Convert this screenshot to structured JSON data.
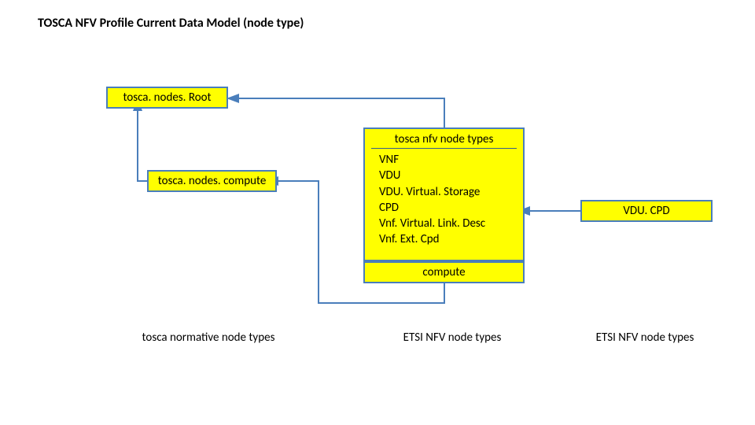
{
  "title": "TOSCA NFV Profile Current Data Model (node type)",
  "boxes": {
    "root": "tosca. nodes. Root",
    "compute": "tosca. nodes. compute",
    "nfv_header": "tosca nfv node types",
    "nfv_items": {
      "i1": "VNF",
      "i2": "VDU",
      "i3": "VDU. Virtual. Storage",
      "i4": "CPD",
      "i5": "Vnf. Virtual. Link. Desc",
      "i6": "Vnf. Ext. Cpd"
    },
    "compute_tag": "compute",
    "vdu_cpd": "VDU. CPD"
  },
  "captions": {
    "left": "tosca normative node types",
    "mid": "ETSI NFV node types",
    "right": "ETSI NFV node types"
  },
  "colors": {
    "box_fill": "#ffff00",
    "box_border": "#4a7ebb",
    "arrow": "#4a7ebb"
  }
}
